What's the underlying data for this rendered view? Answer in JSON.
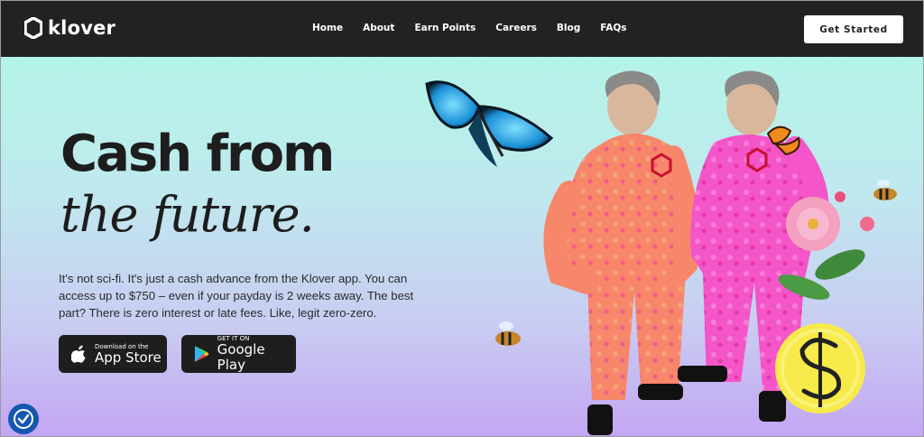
{
  "brand": {
    "name": "klover"
  },
  "nav": {
    "items": [
      "Home",
      "About",
      "Earn Points",
      "Careers",
      "Blog",
      "FAQs"
    ],
    "cta_label": "Get Started"
  },
  "hero": {
    "headline_line1": "Cash from",
    "headline_line2": "the future.",
    "body": "It's not sci-fi. It's just a cash advance from the Klover app. You can access up to $750 – even if your payday is 2 weeks away. The best part? There is zero interest or late fees. Like, legit zero-zero.",
    "app_store": {
      "small": "Download on the",
      "big": "App Store"
    },
    "google_play": {
      "small": "GET IT ON",
      "big": "Google Play"
    }
  },
  "colors": {
    "nav_bg": "#222222",
    "hero_top": "#b4f4e8",
    "hero_bottom": "#c3a6f3",
    "suit_orange": "#f7866a",
    "suit_pink": "#f455c8",
    "coin": "#f7ea4a"
  },
  "icons": {
    "logo": "klover-hexagon-icon",
    "apple": "apple-icon",
    "google_play": "google-play-icon",
    "accessibility": "accessibility-icon"
  }
}
